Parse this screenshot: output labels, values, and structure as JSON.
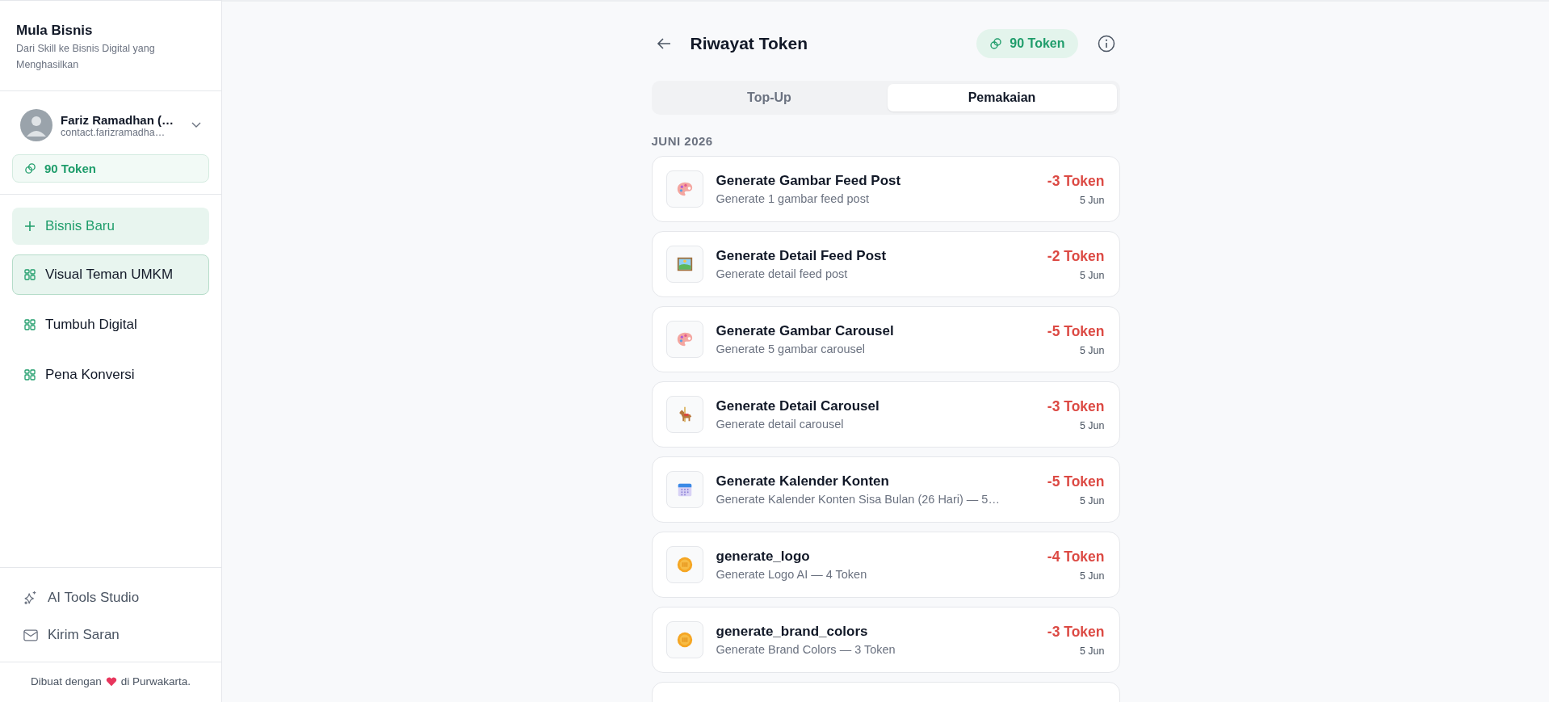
{
  "sidebar": {
    "brand": {
      "title": "Mula Bisnis",
      "subtitle": "Dari Skill ke Bisnis Digital yang Menghasilkan"
    },
    "user": {
      "name": "Fariz Ramadhan (…",
      "email": "contact.farizramadha…"
    },
    "token_balance": "90 Token",
    "new_button": "Bisnis Baru",
    "items": [
      {
        "label": "Visual Teman UMKM",
        "selected": true
      },
      {
        "label": "Tumbuh Digital",
        "selected": false
      },
      {
        "label": "Pena Konversi",
        "selected": false
      }
    ],
    "footer_links": [
      {
        "label": "AI Tools Studio",
        "kind": "sparkle"
      },
      {
        "label": "Kirim Saran",
        "kind": "mail"
      }
    ],
    "credit": {
      "before": "Dibuat dengan",
      "after": "di Purwakarta."
    }
  },
  "header": {
    "title": "Riwayat Token",
    "token_balance": "90 Token"
  },
  "tabs": [
    {
      "label": "Top-Up",
      "selected": false
    },
    {
      "label": "Pemakaian",
      "selected": true
    }
  ],
  "groups": [
    {
      "heading": "JUNI 2026",
      "transactions": [
        {
          "kind": "palette",
          "title": "Generate Gambar Feed Post",
          "description": "Generate 1 gambar feed post",
          "amount": "-3 Token",
          "date": "5 Jun"
        },
        {
          "kind": "picture",
          "title": "Generate Detail Feed Post",
          "description": "Generate detail feed post",
          "amount": "-2 Token",
          "date": "5 Jun"
        },
        {
          "kind": "palette",
          "title": "Generate Gambar Carousel",
          "description": "Generate 5 gambar carousel",
          "amount": "-5 Token",
          "date": "5 Jun"
        },
        {
          "kind": "horse",
          "title": "Generate Detail Carousel",
          "description": "Generate detail carousel",
          "amount": "-3 Token",
          "date": "5 Jun"
        },
        {
          "kind": "calendar",
          "title": "Generate Kalender Konten",
          "description": "Generate Kalender Konten Sisa Bulan (26 Hari) — 5…",
          "amount": "-5 Token",
          "date": "5 Jun"
        },
        {
          "kind": "coin",
          "title": "generate_logo",
          "description": "Generate Logo AI — 4 Token",
          "amount": "-4 Token",
          "date": "5 Jun"
        },
        {
          "kind": "coin",
          "title": "generate_brand_colors",
          "description": "Generate Brand Colors — 3 Token",
          "amount": "-3 Token",
          "date": "5 Jun"
        }
      ]
    }
  ]
}
